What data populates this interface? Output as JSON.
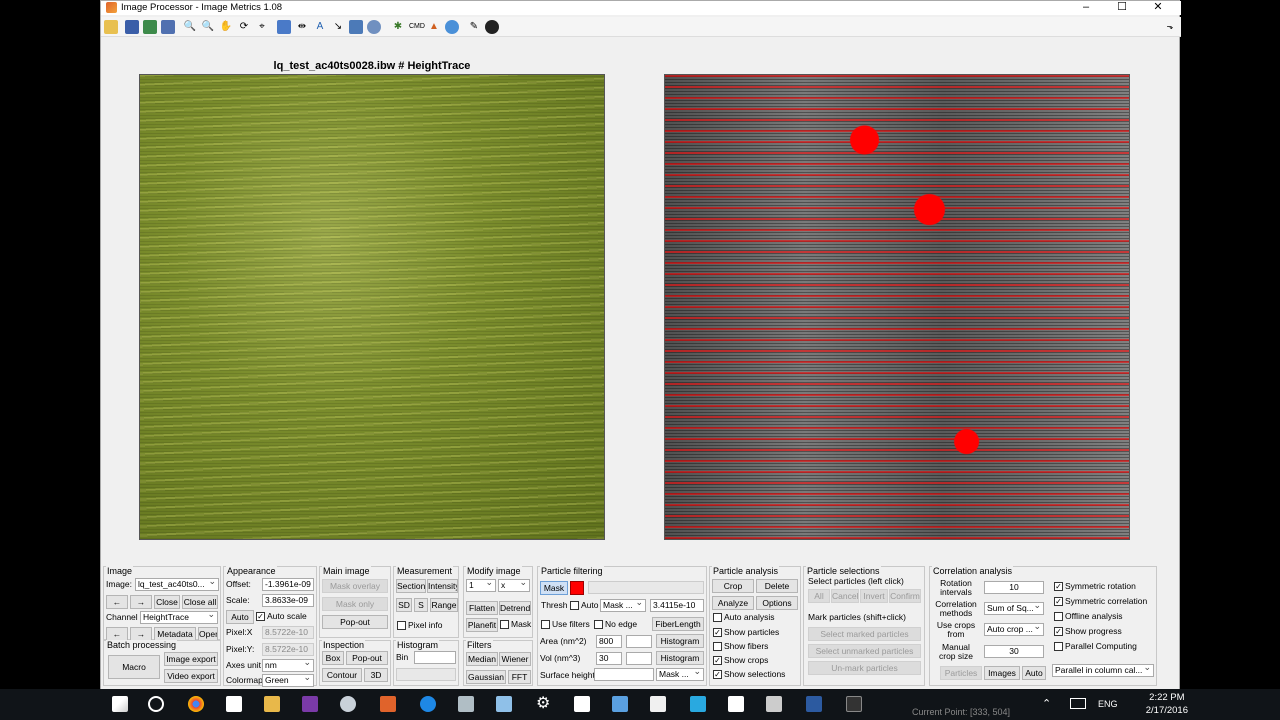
{
  "window": {
    "title": "Image Processor - Image Metrics 1.08"
  },
  "plot": {
    "title": "lq_test_ac40ts0028.ibw # HeightTrace"
  },
  "image": {
    "title": "Image",
    "image_label": "Image:",
    "image_value": "lq_test_ac40ts0...",
    "prev": "←",
    "next": "→",
    "close": "Close",
    "close_all": "Close all",
    "channel_label": "Channel",
    "channel_value": "HeightTrace",
    "prev2": "←",
    "next2": "→",
    "metadata": "Metadata",
    "open": "Open",
    "batch_title": "Batch processing",
    "macro": "Macro",
    "image_export": "Image export",
    "video_export": "Video export"
  },
  "appearance": {
    "title": "Appearance",
    "offset_label": "Offset:",
    "offset_value": "-1.3961e-09",
    "scale_label": "Scale:",
    "scale_value": "3.8633e-09",
    "auto": "Auto",
    "auto_scale": "Auto scale",
    "pixelx_label": "Pixel:X",
    "pixelx_value": "8.5722e-10",
    "pixely_label": "Pixel:Y:",
    "pixely_value": "8.5722e-10",
    "axes_label": "Axes unit",
    "axes_value": "nm",
    "colormap_label": "Colormap",
    "colormap_value": "Green"
  },
  "main_image": {
    "title": "Main image",
    "mask_overlay": "Mask overlay",
    "mask_only": "Mask only",
    "popout": "Pop-out"
  },
  "inspection": {
    "title": "Inspection",
    "box": "Box",
    "popout": "Pop-out",
    "contour": "Contour",
    "three_d": "3D"
  },
  "measurement": {
    "title": "Measurement",
    "section": "Section",
    "intensity": "Intensity",
    "sd": "SD",
    "s": "S",
    "range": "Range",
    "pixel_info": "Pixel info"
  },
  "histogram": {
    "title": "Histogram",
    "bin_label": "Bin"
  },
  "modify": {
    "title": "Modify image",
    "dd1": "1",
    "dd2": "x",
    "flatten": "Flatten",
    "detrend": "Detrend",
    "planefit": "Planefit",
    "mask": "Mask"
  },
  "filters": {
    "title": "Filters",
    "median": "Median",
    "wiener": "Wiener",
    "gaussian": "Gaussian",
    "fft": "FFT"
  },
  "particle_filtering": {
    "title": "Particle filtering",
    "mask": "Mask",
    "thresh": "Thresh",
    "auto": "Auto",
    "mask_dd": "Mask ...",
    "thresh_value": "3.4115e-10",
    "use_filters": "Use filters",
    "no_edge": "No edge",
    "fiberlength": "FiberLength",
    "area_label": "Area (nm^2)",
    "area_value": "800",
    "histogram1": "Histogram",
    "vol_label": "Vol (nm^3)",
    "vol_value": "30",
    "histogram2": "Histogram",
    "surface_label": "Surface height",
    "mask2": "Mask ..."
  },
  "particle_analysis": {
    "title": "Particle analysis",
    "crop": "Crop",
    "delete": "Delete",
    "analyze": "Analyze",
    "options": "Options",
    "auto_analysis": "Auto analysis",
    "show_particles": "Show particles",
    "show_fibers": "Show fibers",
    "show_crops": "Show crops",
    "show_selections": "Show selections"
  },
  "particle_selections": {
    "title": "Particle selections",
    "select_label": "Select particles (left click)",
    "all": "All",
    "cancel": "Cancel",
    "invert": "Invert",
    "confirm": "Confirm",
    "mark_label": "Mark particles (shift+click)",
    "select_marked": "Select marked particles",
    "select_unmarked": "Select unmarked particles",
    "unmark": "Un-mark particles"
  },
  "correlation": {
    "title": "Correlation analysis",
    "rotation_label": "Rotation intervals",
    "rotation_value": "10",
    "methods_label": "Correlation methods",
    "methods_value": "Sum of Sq...",
    "crops_label": "Use crops from",
    "crops_value": "Auto crop ...",
    "manual_label": "Manual crop size",
    "manual_value": "30",
    "particles": "Particles",
    "images": "Images",
    "auto": "Auto",
    "symmetric_rotation": "Symmetric rotation",
    "symmetric_correlation": "Symmetric correlation",
    "offline_analysis": "Offline analysis",
    "show_progress": "Show progress",
    "parallel_computing": "Parallel Computing",
    "parallel_dd": "Parallel in column cal..."
  },
  "taskbar": {
    "lang": "ENG",
    "time": "2:22 PM",
    "date": "2/17/2016",
    "status": "Current Point: [333, 504]"
  }
}
